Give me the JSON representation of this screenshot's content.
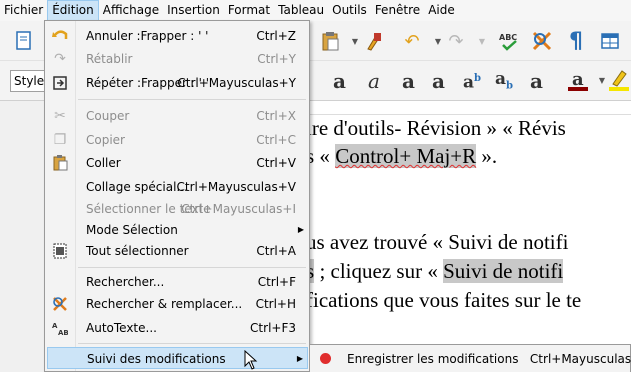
{
  "menubar": {
    "items": [
      "Fichier",
      "Édition",
      "Affichage",
      "Insertion",
      "Format",
      "Tableau",
      "Outils",
      "Fenêtre",
      "Aide"
    ]
  },
  "toolbar": {
    "style_box_value": "Style p"
  },
  "document": {
    "lines": [
      "ire d'outils- Révision » « Révis",
      "s « ",
      "Control+ Maj+R",
      " ».",
      "us avez trouvé « ",
      "Suivi de notifi",
      "s",
      " ; cliquez sur « ",
      " Suivi de notifi",
      "fications que vous faites sur le te"
    ]
  },
  "edit_menu": {
    "items": [
      {
        "icon": "undo-icon",
        "label": "Annuler :Frapper : ' '",
        "shortcut": "Ctrl+Z",
        "enabled": true
      },
      {
        "icon": "redo-icon",
        "label": "Rétablir",
        "shortcut": "Ctrl+Y",
        "enabled": false
      },
      {
        "icon": "repeat-icon",
        "label": "Répéter :Frapper : ' '",
        "shortcut": "Ctrl+Mayusculas+Y",
        "enabled": true
      },
      {
        "icon": "cut-icon",
        "label": "Couper",
        "shortcut": "Ctrl+X",
        "enabled": false
      },
      {
        "icon": "copy-icon",
        "label": "Copier",
        "shortcut": "Ctrl+C",
        "enabled": false
      },
      {
        "icon": "paste-icon",
        "label": "Coller",
        "shortcut": "Ctrl+V",
        "enabled": true
      },
      {
        "icon": "",
        "label": "Collage spécial...",
        "shortcut": "Ctrl+Mayusculas+V",
        "enabled": true
      },
      {
        "icon": "",
        "label": "Sélectionner le texte",
        "shortcut": "Ctrl+Mayusculas+I",
        "enabled": false
      },
      {
        "icon": "",
        "label": "Mode Sélection",
        "shortcut": "",
        "enabled": true,
        "submenu": true
      },
      {
        "icon": "select-all-icon",
        "label": "Tout sélectionner",
        "shortcut": "Ctrl+A",
        "enabled": true
      },
      {
        "icon": "",
        "label": "Rechercher...",
        "shortcut": "Ctrl+F",
        "enabled": true
      },
      {
        "icon": "find-replace-icon",
        "label": "Rechercher & remplacer...",
        "shortcut": "Ctrl+H",
        "enabled": true
      },
      {
        "icon": "autotext-icon",
        "label": "AutoTexte...",
        "shortcut": "Ctrl+F3",
        "enabled": true
      },
      {
        "icon": "",
        "label": "Suivi des modifications",
        "shortcut": "",
        "enabled": true,
        "submenu": true,
        "highlighted": true
      }
    ]
  },
  "track_changes_submenu": {
    "items": [
      {
        "icon": "record-icon",
        "label": "Enregistrer les modifications",
        "shortcut": "Ctrl+Mayusculas+E"
      }
    ]
  },
  "colors": {
    "menu_highlight": "#cce4f7",
    "menu_highlight_border": "#99c9ef",
    "disabled_text": "#8d8d8d",
    "record_red": "#e02d2d"
  }
}
